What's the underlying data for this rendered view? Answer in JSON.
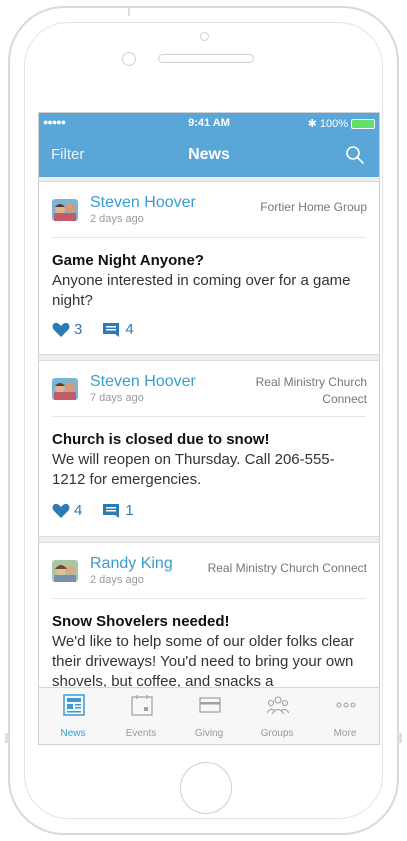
{
  "status": {
    "signal": "●●●●● ",
    "time": "9:41 AM",
    "battery": "100%"
  },
  "nav": {
    "filter": "Filter",
    "title": "News"
  },
  "posts": [
    {
      "author": "Steven Hoover",
      "ago": "2 days ago",
      "group": "Fortier Home Group",
      "title": "Game Night Anyone?",
      "body": "Anyone interested in coming over for a game night?",
      "likes": "3",
      "comments": "4"
    },
    {
      "author": "Steven Hoover",
      "ago": "7 days ago",
      "group_line1": "Real Ministry Church",
      "group_line2": "Connect",
      "title": "Church is closed due to snow!",
      "body": "We will reopen on Thursday. Call 206-555-1212 for emergencies.",
      "likes": "4",
      "comments": "1"
    },
    {
      "author": "Randy King",
      "ago": "2 days ago",
      "group": "Real Ministry Church Connect",
      "title": "Snow Shovelers needed!",
      "body": "We'd like to help some of our older folks clear their driveways! You'd need to bring your own shovels, but coffee, and snacks a"
    }
  ],
  "tabs": [
    {
      "label": "News",
      "icon": "news-icon",
      "active": true
    },
    {
      "label": "Events",
      "icon": "calendar-icon"
    },
    {
      "label": "Giving",
      "icon": "card-icon"
    },
    {
      "label": "Groups",
      "icon": "groups-icon"
    },
    {
      "label": "More",
      "icon": "more-icon"
    }
  ],
  "colors": {
    "accent": "#5aa6d8",
    "link": "#3a9bd2",
    "stat": "#2d7bb5"
  }
}
